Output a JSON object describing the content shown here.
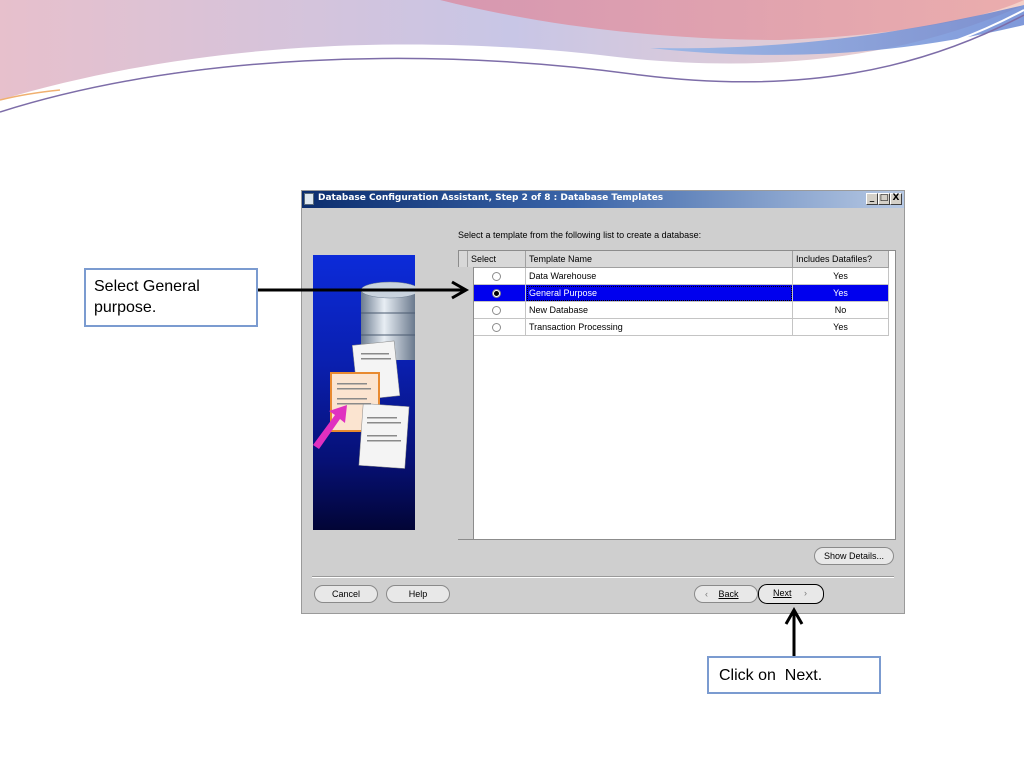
{
  "dialog": {
    "title": "Database Configuration Assistant, Step 2 of 8 : Database Templates",
    "window_controls": [
      "_",
      "□",
      "X"
    ],
    "instruction": "Select a template from the following list to create a database:",
    "table": {
      "headers": [
        "Select",
        "Template Name",
        "Includes Datafiles?"
      ],
      "rows": [
        {
          "name": "Data Warehouse",
          "includes": "Yes",
          "selected": false
        },
        {
          "name": "General Purpose",
          "includes": "Yes",
          "selected": true
        },
        {
          "name": "New Database",
          "includes": "No",
          "selected": false
        },
        {
          "name": "Transaction Processing",
          "includes": "Yes",
          "selected": false
        }
      ]
    },
    "buttons": {
      "show_details": "Show Details...",
      "cancel": "Cancel",
      "help": "Help",
      "back": "Back",
      "next": "Next"
    }
  },
  "callouts": {
    "select_general": "Select General purpose.",
    "click_next": "Click on  Next."
  },
  "colors": {
    "selection": "#0000ee",
    "callout_border": "#7b9bd0",
    "title_bar": "#0b2d6e"
  }
}
